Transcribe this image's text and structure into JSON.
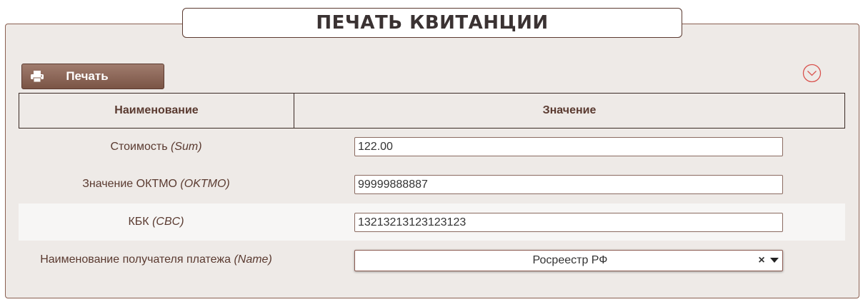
{
  "page": {
    "title": "ПЕЧАТЬ КВИТАНЦИИ"
  },
  "toolbar": {
    "print_label": "Печать",
    "print_icon": "printer-icon",
    "collapse_icon": "chevron-down-circle-icon"
  },
  "table": {
    "headers": [
      "Наименование",
      "Значение"
    ],
    "rows": [
      {
        "label": "Стоимость",
        "key": "(Sum)",
        "value": "122.00"
      },
      {
        "label": "Значение ОКТМО",
        "key": "(OKTMO)",
        "value": "99999888887"
      },
      {
        "label": "КБК",
        "key": "(CBC)",
        "value": "13213213123123123"
      },
      {
        "label": "Наименование получателя платежа",
        "key": "(Name)",
        "value": "Росреестр РФ",
        "clear": "×"
      }
    ]
  },
  "colors": {
    "accent": "#7a5445",
    "panel_bg": "#eeeae7",
    "text": "#5a3a30",
    "collapse_icon": "#d9534f"
  }
}
